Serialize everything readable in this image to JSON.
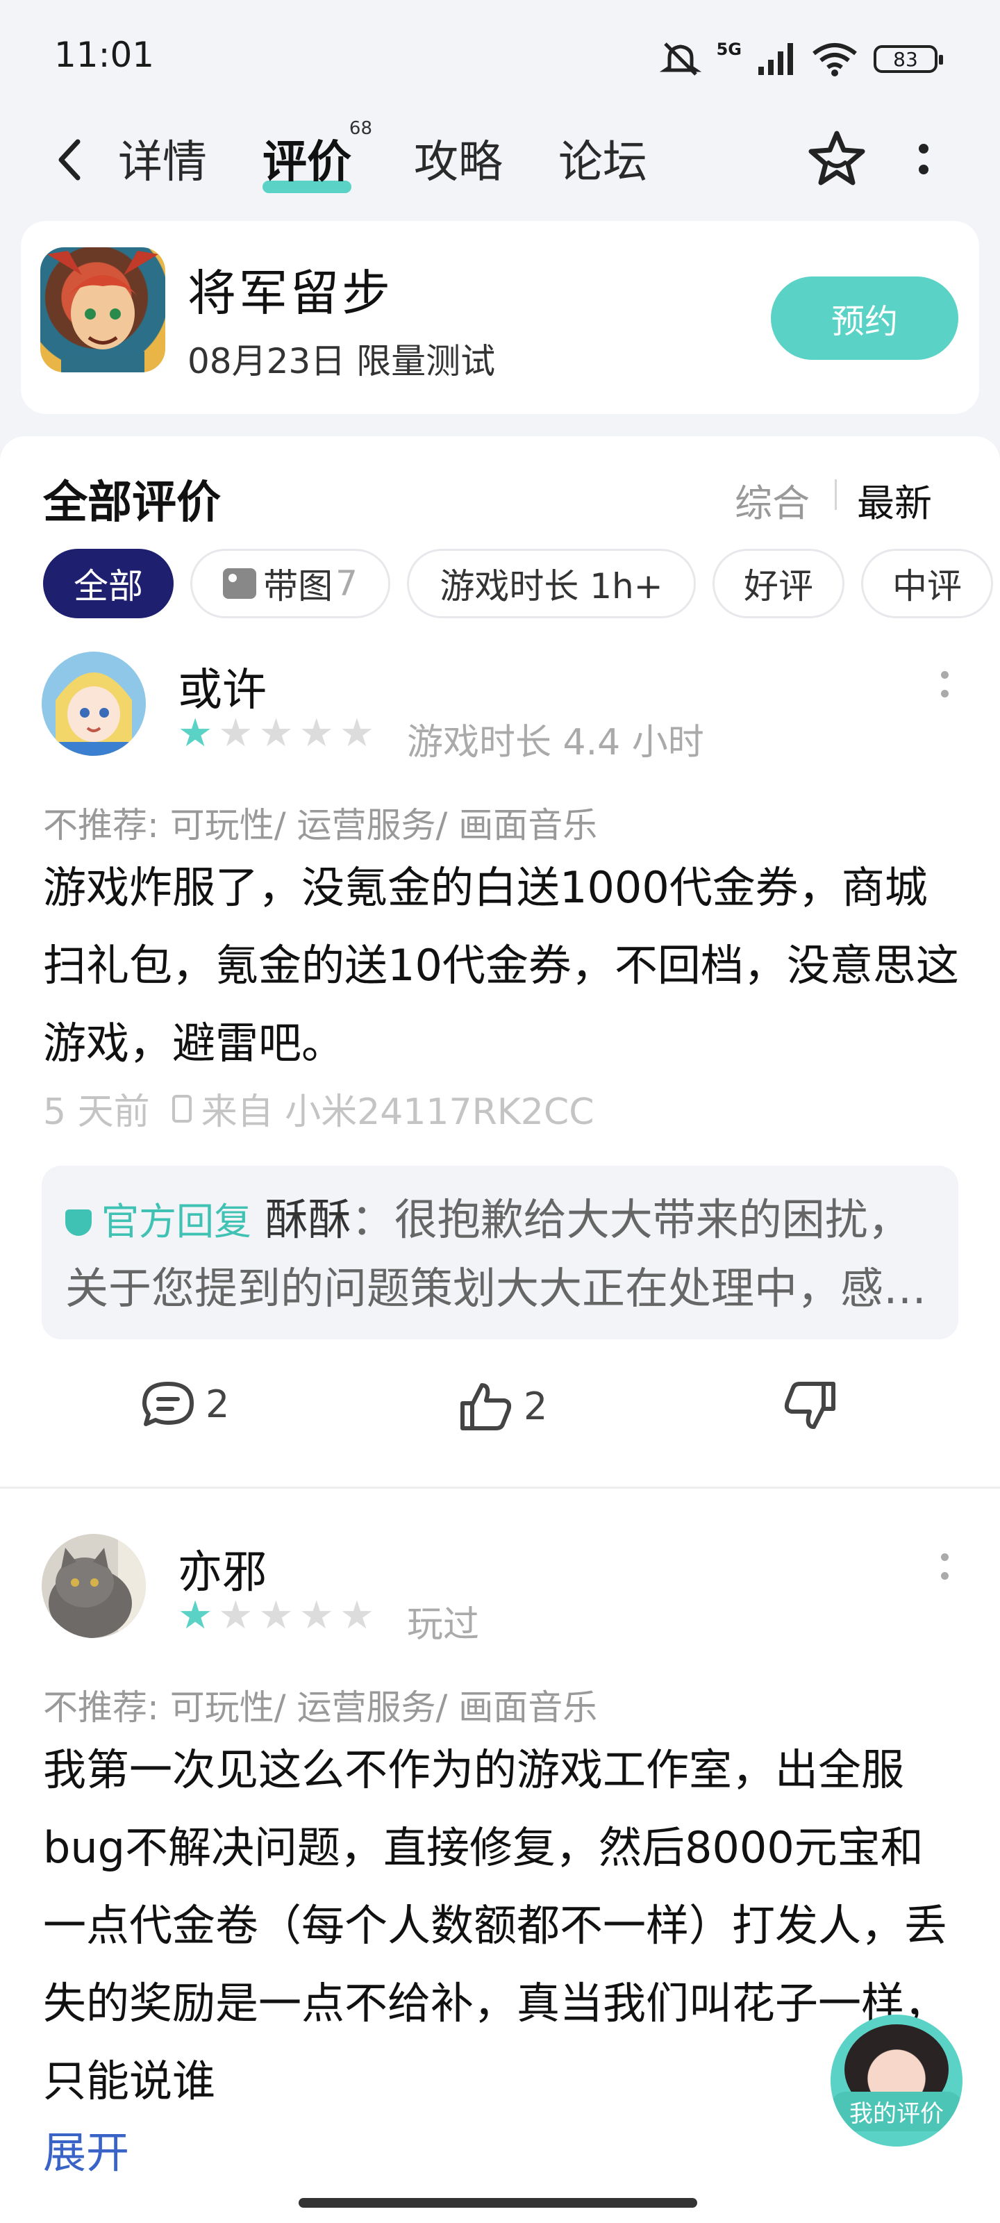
{
  "status_bar": {
    "time": "11:01",
    "network": "5G",
    "battery": "83"
  },
  "nav": {
    "tabs": [
      {
        "label": "详情"
      },
      {
        "label": "评价",
        "badge": "68"
      },
      {
        "label": "攻略"
      },
      {
        "label": "论坛"
      }
    ]
  },
  "game": {
    "title": "将军留步",
    "subtitle": "08月23日 限量测试",
    "action": "预约"
  },
  "reviews_panel": {
    "title": "全部评价",
    "sort_options": [
      "综合",
      "最新"
    ],
    "filters": {
      "all": "全部",
      "with_pics": "带图",
      "with_pics_count": "7",
      "playtime": "游戏时长 1h+",
      "positive": "好评",
      "neutral": "中评"
    }
  },
  "reviews": [
    {
      "name": "或许",
      "rating": 1,
      "playtime": "游戏时长 4.4 小时",
      "tags": "不推荐: 可玩性/ 运营服务/ 画面音乐",
      "body": "游戏炸服了，没氪金的白送1000代金券，商城扫礼包，氪金的送10代金券，不回档，没意思这游戏，避雷吧。",
      "time": "5 天前",
      "device": "来自 小米24117RK2CC",
      "reply": {
        "label": "官方回复",
        "author": "酥酥",
        "text": "：很抱歉给大大带来的困扰，关于您提到的问题策划大大正在处理中，感谢您的反馈"
      },
      "comments": "2",
      "likes": "2"
    },
    {
      "name": "亦邪",
      "rating": 1,
      "playtime": "玩过",
      "tags": "不推荐: 可玩性/ 运营服务/ 画面音乐",
      "body": "我第一次见这么不作为的游戏工作室，出全服bug不解决问题，直接修复，然后8000元宝和一点代金卷（每个人数额都不一样）打发人，丢失的奖励是一点不给补，真当我们叫花子一样，只能说谁",
      "expand": "展开"
    }
  ],
  "floating": {
    "label": "我的评价"
  },
  "colors": {
    "accent": "#5ad3c6",
    "chip_active": "#1e1f6e",
    "link": "#3a63c8"
  }
}
